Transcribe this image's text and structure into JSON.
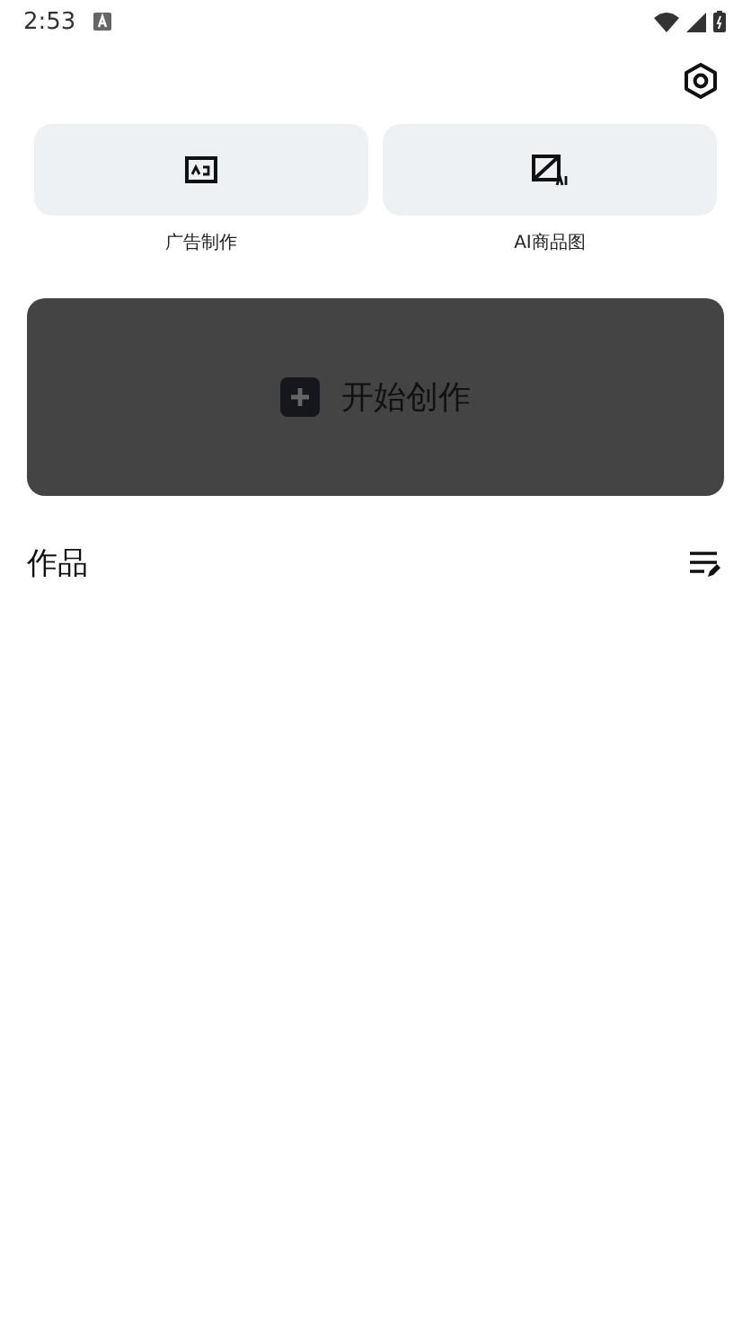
{
  "status_bar": {
    "time": "2:53"
  },
  "tools": [
    {
      "kind": "ad",
      "label": "广告制作"
    },
    {
      "kind": "ai-image",
      "label": "AI商品图"
    }
  ],
  "create_button": {
    "label": "开始创作"
  },
  "works": {
    "title": "作品"
  }
}
